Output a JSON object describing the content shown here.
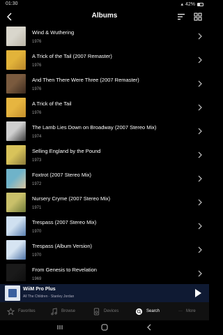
{
  "status": {
    "time": "01:30",
    "battery": "42%"
  },
  "header": {
    "title": "Albums"
  },
  "albums": [
    {
      "title": "Wind & Wuthering",
      "year": "1976",
      "art": [
        "#d9d6cc",
        "#b9b4a6"
      ]
    },
    {
      "title": "A Trick of the Tail (2007 Remaster)",
      "year": "1976",
      "art": [
        "#e2b33a",
        "#b8862a"
      ]
    },
    {
      "title": "And Then There Were Three (2007 Remaster)",
      "year": "1976",
      "art": [
        "#7a5a3e",
        "#3d2b1f"
      ]
    },
    {
      "title": "A Trick of the Tail",
      "year": "1976",
      "art": [
        "#e6b540",
        "#c48f2c"
      ]
    },
    {
      "title": "The Lamb Lies Down on Broadway  (2007 Stereo Mix)",
      "year": "1974",
      "art": [
        "#cfcfcf",
        "#3b3b3b"
      ]
    },
    {
      "title": "Selling England by the Pound",
      "year": "1973",
      "art": [
        "#d8c35a",
        "#8a7a3a"
      ]
    },
    {
      "title": "Foxtrot (2007 Stereo Mix)",
      "year": "1972",
      "art": [
        "#6fb3c9",
        "#d9c6a2"
      ]
    },
    {
      "title": "Nursery Cryme  (2007 Stereo Mix)",
      "year": "1971",
      "art": [
        "#c9c06a",
        "#6f7a3a"
      ]
    },
    {
      "title": "Trespass  (2007 Stereo Mix)",
      "year": "1970",
      "art": [
        "#cfe0f0",
        "#5a7fb0"
      ]
    },
    {
      "title": "Trespass (Album Version)",
      "year": "1970",
      "art": [
        "#d6e4f2",
        "#4f74a8"
      ]
    },
    {
      "title": "From Genesis to Revelation",
      "year": "1969",
      "art": [
        "#1a1a1a",
        "#0d0d0d"
      ]
    }
  ],
  "now_playing": {
    "device": "WiiM Pro Plus",
    "track": "All The Children · Stanley Jordan"
  },
  "nav": {
    "favorites": "Favorites",
    "browse": "Browse",
    "devices": "Devices",
    "search": "Search",
    "more": "More"
  },
  "colors": {
    "accent": "#ffffff",
    "now_playing_bg": "#0f1a33",
    "nav_inactive": "#777777"
  }
}
